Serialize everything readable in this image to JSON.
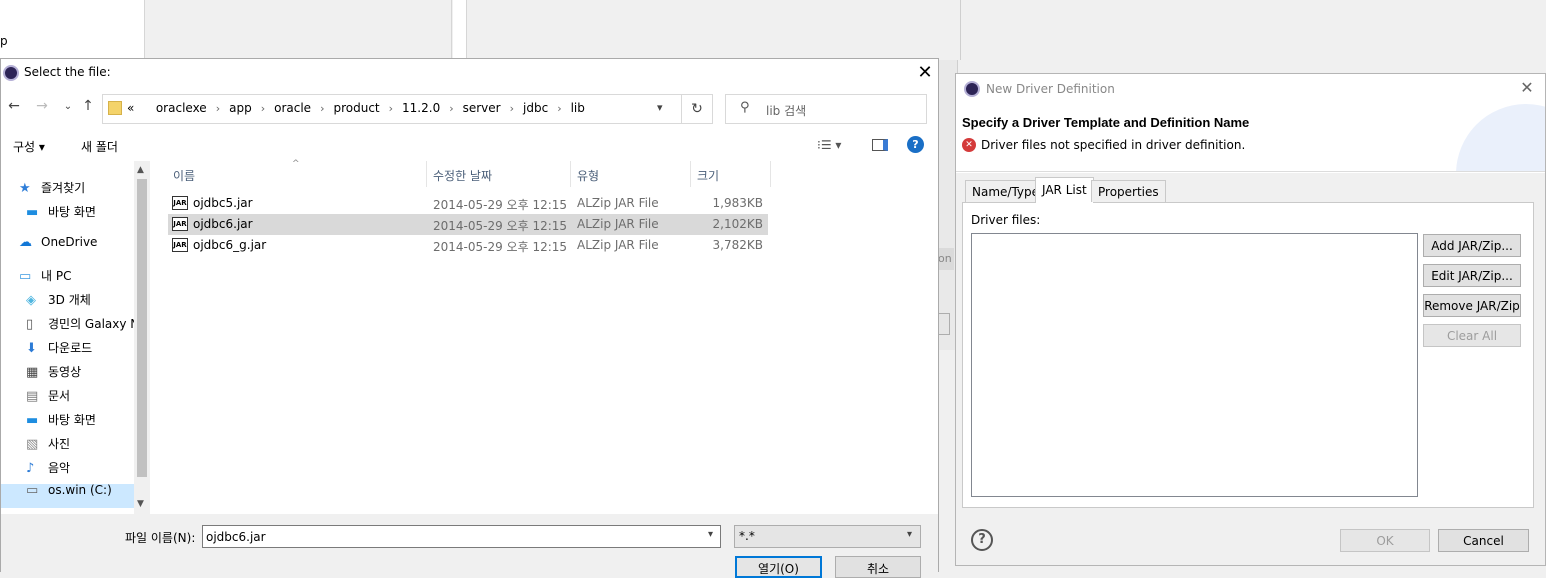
{
  "background": {
    "left_partial_text": "p",
    "right_partial_button": "on"
  },
  "file_dialog": {
    "title": "Select the file:",
    "close_glyph": "✕",
    "nav": {
      "back": "←",
      "forward": "→",
      "history": "⌄",
      "up": "↑"
    },
    "breadcrumb_prefix": "«",
    "breadcrumbs": [
      "oraclexe",
      "app",
      "oracle",
      "product",
      "11.2.0",
      "server",
      "jdbc",
      "lib"
    ],
    "refresh_glyph": "↻",
    "search_placeholder": "lib 검색",
    "toolbar": {
      "organize": "구성 ▾",
      "new_folder": "새 폴더",
      "view": "⁝☰ ▾",
      "help": "?"
    },
    "nav_pane": [
      {
        "label": "즐겨찾기",
        "icon": "star-icon",
        "color": "#2f7ed8"
      },
      {
        "label": "바탕 화면",
        "icon": "desktop-icon",
        "color": "#1e8de0",
        "sub": true
      },
      {
        "label": "OneDrive",
        "icon": "cloud-icon",
        "color": "#1277d6"
      },
      {
        "label": "내 PC",
        "icon": "computer-icon",
        "color": "#3d9be0"
      },
      {
        "label": "3D 개체",
        "icon": "cube-icon",
        "color": "#4fb6e0",
        "sub": true
      },
      {
        "label": "경민의 Galaxy N",
        "icon": "phone-icon",
        "color": "#555555",
        "sub": true
      },
      {
        "label": "다운로드",
        "icon": "download-icon",
        "color": "#2c7bd6",
        "sub": true
      },
      {
        "label": "동영상",
        "icon": "film-icon",
        "color": "#444444",
        "sub": true
      },
      {
        "label": "문서",
        "icon": "document-icon",
        "color": "#777777",
        "sub": true
      },
      {
        "label": "바탕 화면",
        "icon": "desktop-icon",
        "color": "#1e8de0",
        "sub": true
      },
      {
        "label": "사진",
        "icon": "picture-icon",
        "color": "#888888",
        "sub": true
      },
      {
        "label": "음악",
        "icon": "music-icon",
        "color": "#2c7bd6",
        "sub": true
      },
      {
        "label": "os.win (C:)",
        "icon": "drive-icon",
        "color": "#666666",
        "sub": true
      }
    ],
    "columns": [
      "이름",
      "수정한 날짜",
      "유형",
      "크기"
    ],
    "files": [
      {
        "name": "ojdbc5.jar",
        "date": "2014-05-29 오후 12:15",
        "type": "ALZip JAR File",
        "size": "1,983KB"
      },
      {
        "name": "ojdbc6.jar",
        "date": "2014-05-29 오후 12:15",
        "type": "ALZip JAR File",
        "size": "2,102KB"
      },
      {
        "name": "ojdbc6_g.jar",
        "date": "2014-05-29 오후 12:15",
        "type": "ALZip JAR File",
        "size": "3,782KB"
      }
    ],
    "selected_index": 1,
    "jar_icon_text": "JAR",
    "filename_label": "파일 이름(N):",
    "filename_value": "ojdbc6.jar",
    "filetype_value": "*.*",
    "open_button": "열기(O)",
    "cancel_button": "취소"
  },
  "driver_dialog": {
    "title": "New Driver Definition",
    "close_glyph": "✕",
    "heading": "Specify a Driver Template and Definition Name",
    "error_glyph": "✕",
    "error_message": "Driver files not specified in driver definition.",
    "tabs": [
      "Name/Type",
      "JAR List",
      "Properties"
    ],
    "active_tab": "JAR List",
    "driver_files_label": "Driver files:",
    "buttons": {
      "add": "Add JAR/Zip...",
      "edit": "Edit JAR/Zip...",
      "remove": "Remove JAR/Zip",
      "clear": "Clear All"
    },
    "help_glyph": "?",
    "ok": "OK",
    "cancel": "Cancel"
  }
}
